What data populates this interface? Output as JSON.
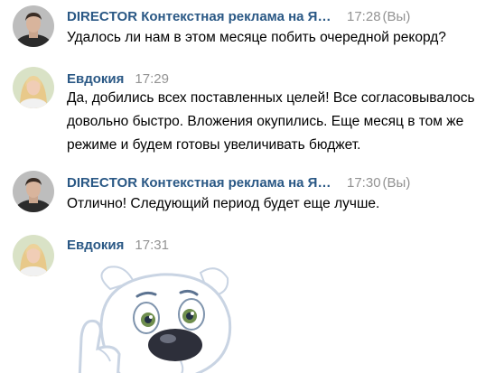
{
  "messages": [
    {
      "author": "DIRECTOR Контекстная реклама на Ян...",
      "time": "17:28",
      "suffix": "(Вы)",
      "text": "Удалось ли нам в этом месяце побить очередной рекорд?",
      "avatar": "man-avatar"
    },
    {
      "author": "Евдокия",
      "time": "17:29",
      "suffix": "",
      "text": "Да, добились всех поставленных целей! Все согласовывалось довольно быстро. Вложения окупились. Еще месяц в том же режиме и будем готовы увеличивать бюджет.",
      "avatar": "woman-avatar"
    },
    {
      "author": "DIRECTOR Контекстная реклама на Ян...",
      "time": "17:30",
      "suffix": "(Вы)",
      "text": "Отлично! Следующий период будет еще лучше.",
      "avatar": "man-avatar"
    },
    {
      "author": "Евдокия",
      "time": "17:31",
      "suffix": "",
      "text": "",
      "avatar": "woman-avatar",
      "sticker": "dog-thumbs-up-sticker"
    }
  ],
  "colors": {
    "author": "#2a5885",
    "time": "#939393",
    "text": "#000000",
    "background": "#ffffff"
  }
}
